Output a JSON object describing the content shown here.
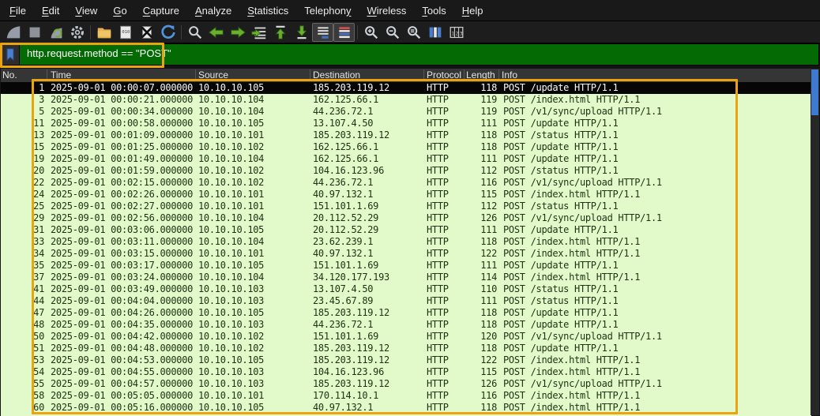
{
  "menu": {
    "items": [
      {
        "label": "File",
        "accel_index": 0
      },
      {
        "label": "Edit",
        "accel_index": 0
      },
      {
        "label": "View",
        "accel_index": 0
      },
      {
        "label": "Go",
        "accel_index": 0
      },
      {
        "label": "Capture",
        "accel_index": 0
      },
      {
        "label": "Analyze",
        "accel_index": 0
      },
      {
        "label": "Statistics",
        "accel_index": 0
      },
      {
        "label": "Telephony",
        "accel_index": 8
      },
      {
        "label": "Wireless",
        "accel_index": 0
      },
      {
        "label": "Tools",
        "accel_index": 0
      },
      {
        "label": "Help",
        "accel_index": 0
      }
    ]
  },
  "toolbar": {
    "icons": [
      "start-capture-icon",
      "stop-capture-icon",
      "restart-capture-icon",
      "capture-options-icon",
      "open-file-icon",
      "save-file-icon",
      "close-file-icon",
      "reload-file-icon",
      "find-packet-icon",
      "go-back-icon",
      "go-forward-icon",
      "go-to-packet-icon",
      "go-first-packet-icon",
      "go-last-packet-icon",
      "auto-scroll-icon",
      "colorize-icon",
      "zoom-in-icon",
      "zoom-out-icon",
      "zoom-original-icon",
      "resize-columns-icon",
      "display-columns-icon"
    ],
    "pressed": [
      "auto-scroll-icon",
      "colorize-icon"
    ]
  },
  "filter": {
    "value": "http.request.method == \"POST\""
  },
  "packet_table": {
    "columns": [
      "No.",
      "Time",
      "Source",
      "Destination",
      "Protocol",
      "Length",
      "Info"
    ],
    "rows": [
      {
        "no": "1",
        "time": "2025-09-01 00:00:07.000000",
        "src": "10.10.10.105",
        "dst": "185.203.119.12",
        "proto": "HTTP",
        "len": "118",
        "info": "POST /update HTTP/1.1",
        "selected": true
      },
      {
        "no": "3",
        "time": "2025-09-01 00:00:21.000000",
        "src": "10.10.10.104",
        "dst": "162.125.66.1",
        "proto": "HTTP",
        "len": "119",
        "info": "POST /index.html HTTP/1.1",
        "selected": false
      },
      {
        "no": "5",
        "time": "2025-09-01 00:00:34.000000",
        "src": "10.10.10.104",
        "dst": "44.236.72.1",
        "proto": "HTTP",
        "len": "119",
        "info": "POST /v1/sync/upload HTTP/1.1",
        "selected": false
      },
      {
        "no": "11",
        "time": "2025-09-01 00:00:58.000000",
        "src": "10.10.10.105",
        "dst": "13.107.4.50",
        "proto": "HTTP",
        "len": "111",
        "info": "POST /update HTTP/1.1",
        "selected": false
      },
      {
        "no": "13",
        "time": "2025-09-01 00:01:09.000000",
        "src": "10.10.10.101",
        "dst": "185.203.119.12",
        "proto": "HTTP",
        "len": "118",
        "info": "POST /status HTTP/1.1",
        "selected": false
      },
      {
        "no": "15",
        "time": "2025-09-01 00:01:25.000000",
        "src": "10.10.10.102",
        "dst": "162.125.66.1",
        "proto": "HTTP",
        "len": "118",
        "info": "POST /update HTTP/1.1",
        "selected": false
      },
      {
        "no": "19",
        "time": "2025-09-01 00:01:49.000000",
        "src": "10.10.10.104",
        "dst": "162.125.66.1",
        "proto": "HTTP",
        "len": "111",
        "info": "POST /update HTTP/1.1",
        "selected": false
      },
      {
        "no": "20",
        "time": "2025-09-01 00:01:59.000000",
        "src": "10.10.10.102",
        "dst": "104.16.123.96",
        "proto": "HTTP",
        "len": "112",
        "info": "POST /status HTTP/1.1",
        "selected": false
      },
      {
        "no": "22",
        "time": "2025-09-01 00:02:15.000000",
        "src": "10.10.10.102",
        "dst": "44.236.72.1",
        "proto": "HTTP",
        "len": "116",
        "info": "POST /v1/sync/upload HTTP/1.1",
        "selected": false
      },
      {
        "no": "24",
        "time": "2025-09-01 00:02:26.000000",
        "src": "10.10.10.101",
        "dst": "40.97.132.1",
        "proto": "HTTP",
        "len": "115",
        "info": "POST /index.html HTTP/1.1",
        "selected": false
      },
      {
        "no": "25",
        "time": "2025-09-01 00:02:27.000000",
        "src": "10.10.10.101",
        "dst": "151.101.1.69",
        "proto": "HTTP",
        "len": "112",
        "info": "POST /status HTTP/1.1",
        "selected": false
      },
      {
        "no": "29",
        "time": "2025-09-01 00:02:56.000000",
        "src": "10.10.10.104",
        "dst": "20.112.52.29",
        "proto": "HTTP",
        "len": "126",
        "info": "POST /v1/sync/upload HTTP/1.1",
        "selected": false
      },
      {
        "no": "31",
        "time": "2025-09-01 00:03:06.000000",
        "src": "10.10.10.105",
        "dst": "20.112.52.29",
        "proto": "HTTP",
        "len": "111",
        "info": "POST /update HTTP/1.1",
        "selected": false
      },
      {
        "no": "33",
        "time": "2025-09-01 00:03:11.000000",
        "src": "10.10.10.104",
        "dst": "23.62.239.1",
        "proto": "HTTP",
        "len": "118",
        "info": "POST /index.html HTTP/1.1",
        "selected": false
      },
      {
        "no": "34",
        "time": "2025-09-01 00:03:15.000000",
        "src": "10.10.10.101",
        "dst": "40.97.132.1",
        "proto": "HTTP",
        "len": "122",
        "info": "POST /index.html HTTP/1.1",
        "selected": false
      },
      {
        "no": "35",
        "time": "2025-09-01 00:03:17.000000",
        "src": "10.10.10.105",
        "dst": "151.101.1.69",
        "proto": "HTTP",
        "len": "111",
        "info": "POST /update HTTP/1.1",
        "selected": false
      },
      {
        "no": "37",
        "time": "2025-09-01 00:03:24.000000",
        "src": "10.10.10.104",
        "dst": "34.120.177.193",
        "proto": "HTTP",
        "len": "114",
        "info": "POST /index.html HTTP/1.1",
        "selected": false
      },
      {
        "no": "41",
        "time": "2025-09-01 00:03:49.000000",
        "src": "10.10.10.103",
        "dst": "13.107.4.50",
        "proto": "HTTP",
        "len": "110",
        "info": "POST /status HTTP/1.1",
        "selected": false
      },
      {
        "no": "44",
        "time": "2025-09-01 00:04:04.000000",
        "src": "10.10.10.103",
        "dst": "23.45.67.89",
        "proto": "HTTP",
        "len": "111",
        "info": "POST /status HTTP/1.1",
        "selected": false
      },
      {
        "no": "47",
        "time": "2025-09-01 00:04:26.000000",
        "src": "10.10.10.105",
        "dst": "185.203.119.12",
        "proto": "HTTP",
        "len": "118",
        "info": "POST /update HTTP/1.1",
        "selected": false
      },
      {
        "no": "48",
        "time": "2025-09-01 00:04:35.000000",
        "src": "10.10.10.103",
        "dst": "44.236.72.1",
        "proto": "HTTP",
        "len": "118",
        "info": "POST /update HTTP/1.1",
        "selected": false
      },
      {
        "no": "50",
        "time": "2025-09-01 00:04:42.000000",
        "src": "10.10.10.102",
        "dst": "151.101.1.69",
        "proto": "HTTP",
        "len": "120",
        "info": "POST /v1/sync/upload HTTP/1.1",
        "selected": false
      },
      {
        "no": "51",
        "time": "2025-09-01 00:04:48.000000",
        "src": "10.10.10.102",
        "dst": "185.203.119.12",
        "proto": "HTTP",
        "len": "118",
        "info": "POST /update HTTP/1.1",
        "selected": false
      },
      {
        "no": "53",
        "time": "2025-09-01 00:04:53.000000",
        "src": "10.10.10.105",
        "dst": "185.203.119.12",
        "proto": "HTTP",
        "len": "122",
        "info": "POST /index.html HTTP/1.1",
        "selected": false
      },
      {
        "no": "54",
        "time": "2025-09-01 00:04:55.000000",
        "src": "10.10.10.103",
        "dst": "104.16.123.96",
        "proto": "HTTP",
        "len": "115",
        "info": "POST /index.html HTTP/1.1",
        "selected": false
      },
      {
        "no": "55",
        "time": "2025-09-01 00:04:57.000000",
        "src": "10.10.10.103",
        "dst": "185.203.119.12",
        "proto": "HTTP",
        "len": "126",
        "info": "POST /v1/sync/upload HTTP/1.1",
        "selected": false
      },
      {
        "no": "58",
        "time": "2025-09-01 00:05:05.000000",
        "src": "10.10.10.101",
        "dst": "170.114.10.1",
        "proto": "HTTP",
        "len": "116",
        "info": "POST /index.html HTTP/1.1",
        "selected": false
      },
      {
        "no": "60",
        "time": "2025-09-01 00:05:16.000000",
        "src": "10.10.10.105",
        "dst": "40.97.132.1",
        "proto": "HTTP",
        "len": "118",
        "info": "POST /index.html HTTP/1.1",
        "selected": false
      }
    ]
  },
  "colors": {
    "filter_valid_green": "#046a04",
    "http_row_green": "#e2fac9",
    "selected_row": "#060606",
    "annotation_yellow": "#eaa40f",
    "scroll_thumb_blue": "#3f7ad1"
  }
}
